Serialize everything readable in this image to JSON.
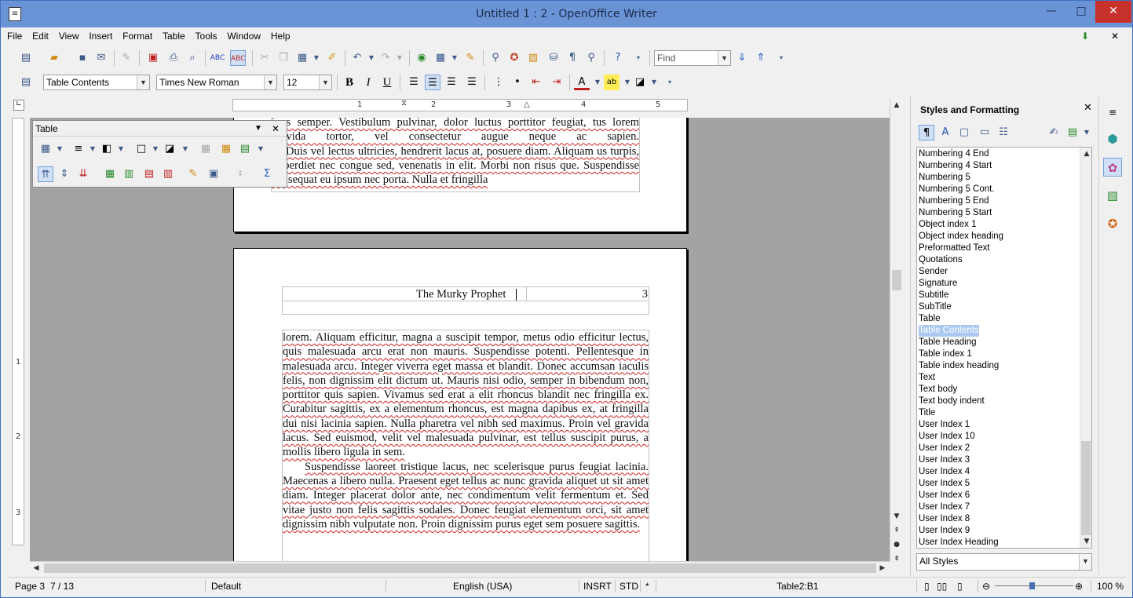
{
  "window": {
    "title": "Untitled 1 : 2 - OpenOffice Writer",
    "minimize": "—",
    "maximize": "□",
    "close": "✕"
  },
  "menu": {
    "items": [
      "File",
      "Edit",
      "View",
      "Insert",
      "Format",
      "Table",
      "Tools",
      "Window",
      "Help"
    ],
    "doc_close": "✕"
  },
  "toolbar": {
    "find_placeholder": "Find"
  },
  "formatting": {
    "paragraph_style": "Table Contents",
    "font_name": "Times New Roman",
    "font_size": "12"
  },
  "ruler": {
    "labels": [
      "1",
      "2",
      "3",
      "4",
      "5"
    ],
    "vlabels": [
      "1",
      "2",
      "3"
    ]
  },
  "table_toolbar": {
    "title": "Table"
  },
  "document": {
    "page1_text": "ipus semper. Vestibulum pulvinar, dolor luctus porttitor feugiat, tus lorem gravida tortor, vel consectetur augue neque ac sapien.",
    "page1_para2": "Duis vel lectus ultricies, hendrerit lacus at, posuere diam. Aliquam us turpis, imperdiet nec congue sed, venenatis in elit. Morbi non risus que. Suspendisse consequat eu ipsum nec porta. Nulla et fringilla",
    "header_title": "The Murky Prophet",
    "page_number": "3",
    "para1": "lorem. Aliquam efficitur, magna a suscipit tempor, metus odio efficitur lectus, quis malesuada arcu erat non mauris. Suspendisse potenti. Pellentesque in malesuada arcu. Integer viverra eget massa et blandit. Donec accumsan iaculis felis, non dignissim elit dictum ut. Mauris nisi odio, semper in bibendum non, porttitor quis sapien. Vivamus sed erat a elit rhoncus blandit nec fringilla ex. Curabitur sagittis, ex a elementum rhoncus, est magna dapibus ex, at fringilla dui nisi lacinia sapien. Nulla pharetra vel nibh sed maximus. Proin vel gravida lacus. Sed euismod, velit vel malesuada pulvinar, est tellus suscipit purus, a mollis libero ligula in sem.",
    "para2": "Suspendisse laoreet tristique lacus, nec scelerisque purus feugiat lacinia. Maecenas a libero nulla. Praesent eget tellus ac nunc gravida aliquet ut sit amet diam. Integer placerat dolor ante, nec condimentum velit fermentum et. Sed vitae justo non felis sagittis sodales. Donec feugiat elementum orci, sit amet dignissim nibh vulputate non. Proin dignissim purus eget sem posuere sagittis."
  },
  "styles_panel": {
    "title": "Styles and Formatting",
    "close": "✕",
    "items": [
      "Numbering 4 End",
      "Numbering 4 Start",
      "Numbering 5",
      "Numbering 5 Cont.",
      "Numbering 5 End",
      "Numbering 5 Start",
      "Object index 1",
      "Object index heading",
      "Preformatted Text",
      "Quotations",
      "Sender",
      "Signature",
      "Subtitle",
      "SubTitle",
      "Table",
      "Table Contents",
      "Table Heading",
      "Table index 1",
      "Table index heading",
      "Text",
      "Text body",
      "Text body indent",
      "Title",
      "User Index 1",
      "User Index 10",
      "User Index 2",
      "User Index 3",
      "User Index 4",
      "User Index 5",
      "User Index 6",
      "User Index 7",
      "User Index 8",
      "User Index 9",
      "User Index Heading"
    ],
    "selected": "Table Contents",
    "filter": "All Styles"
  },
  "status": {
    "page": "Page 3",
    "page_count": "7 / 13",
    "page_style": "Default",
    "language": "English (USA)",
    "insert_mode": "INSRT",
    "selection_mode": "STD",
    "modified": "*",
    "cell": "Table2:B1",
    "zoom": "100 %"
  }
}
